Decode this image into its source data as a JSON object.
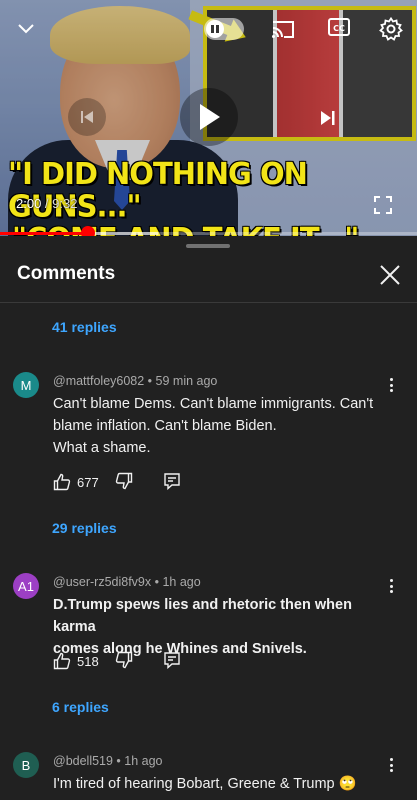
{
  "player": {
    "headline_line1": "\"I DID NOTHING ON GUNS...\"",
    "headline_line2": "\"COME AND TAKE IT...\"",
    "current_time": "2:00",
    "separator": " / ",
    "duration": "9:32",
    "progress_fraction": 0.21,
    "buffer_fraction": 0.38,
    "icons": [
      "chevron-down-icon",
      "pause-icon",
      "cast-icon",
      "closed-captions-icon",
      "settings-gear-icon",
      "previous-icon",
      "play-icon",
      "next-icon",
      "fullscreen-icon"
    ]
  },
  "comments_panel": {
    "title": "Comments",
    "close_icon": "close-icon",
    "threads": [
      {
        "replies_label": "41 replies"
      },
      {
        "avatar_initial": "M",
        "avatar_color": "#1a8a8a",
        "meta": "@mattfoley6082 • 59 min ago",
        "lines": [
          "Can't blame Dems. Can't blame immigrants. Can't",
          "blame inflation. Can't blame Biden.",
          "What a shame."
        ],
        "likes": "677",
        "replies_label": "29 replies"
      },
      {
        "avatar_initial": "A1",
        "avatar_color": "#9c3fc4",
        "meta": "@user-rz5di8fv9x • 1h ago",
        "lines": [
          "D.Trump spews lies and rhetoric then when karma",
          "comes along he Whines and Snivels."
        ],
        "likes": "518",
        "replies_label": "6 replies"
      },
      {
        "avatar_initial": "B",
        "avatar_color": "#1f5e52",
        "meta": "@bdell519 • 1h ago",
        "lines": [
          "I'm tired of hearing Bobart,  Greene  & Trump 🙄"
        ]
      }
    ]
  }
}
